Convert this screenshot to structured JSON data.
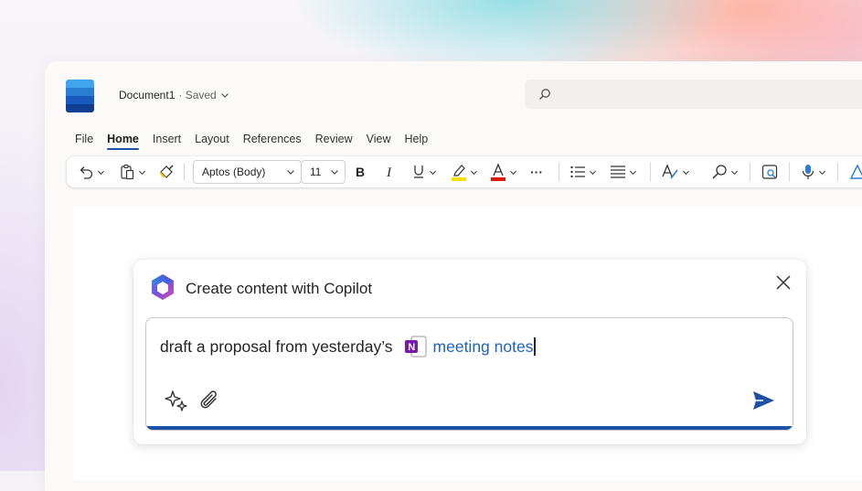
{
  "document": {
    "name": "Document1",
    "status": "· Saved"
  },
  "menu": {
    "items": [
      "File",
      "Home",
      "Insert",
      "Layout",
      "References",
      "Review",
      "View",
      "Help"
    ],
    "active": "Home"
  },
  "ribbon": {
    "font_name": "Aptos (Body)",
    "font_size": "11",
    "more": "···"
  },
  "copilot": {
    "title": "Create content with Copilot",
    "prompt_text": "draft a proposal from yesterday’s",
    "file_reference": "meeting notes"
  },
  "colors": {
    "accent": "#1d50a6",
    "link": "#2062c2",
    "highlight": "#f7e100",
    "font_color": "#e0190f",
    "onenote": "#7719aa"
  },
  "icons": [
    "word-logo",
    "search-icon",
    "undo-icon",
    "paste-icon",
    "format-painter-icon",
    "bold-icon",
    "italic-icon",
    "underline-icon",
    "highlighter-icon",
    "font-color-icon",
    "bullets-icon",
    "align-icon",
    "styles-icon",
    "find-icon",
    "editor-icon",
    "dictate-icon",
    "copilot-icon",
    "close-icon",
    "onenote-icon",
    "sparkle-icon",
    "paperclip-icon",
    "send-icon"
  ]
}
